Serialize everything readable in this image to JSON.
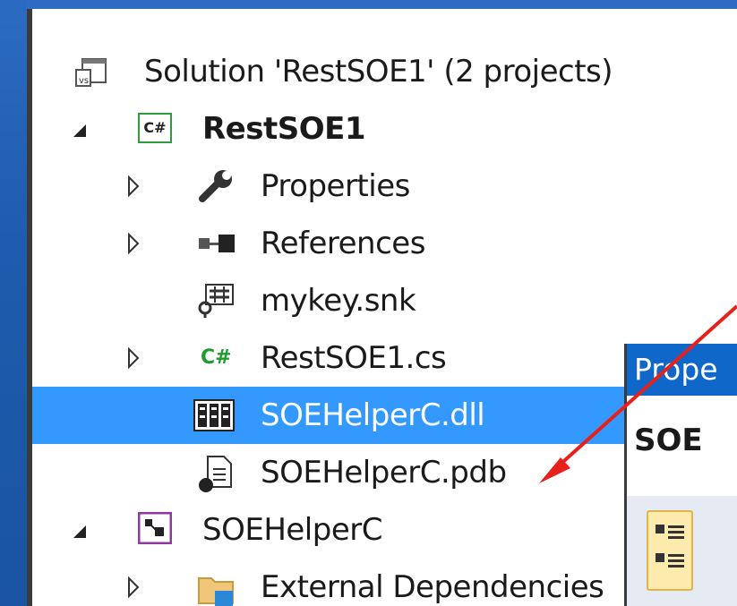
{
  "tree": {
    "solution_label": "Solution 'RestSOE1' (2 projects)",
    "project1_label": "RestSOE1",
    "properties_label": "Properties",
    "references_label": "References",
    "mykey_label": "mykey.snk",
    "restsoe1_cs_label": "RestSOE1.cs",
    "dll_label": "SOEHelperC.dll",
    "pdb_label": "SOEHelperC.pdb",
    "project2_label": "SOEHelperC",
    "extdeps_label": "External Dependencies",
    "csharp_badge": "C#"
  },
  "properties_panel": {
    "title": "Prope",
    "object": "SOE"
  },
  "colors": {
    "selection": "#3399ff",
    "arrow": "#e8201c",
    "panel_title": "#0f67c9"
  }
}
